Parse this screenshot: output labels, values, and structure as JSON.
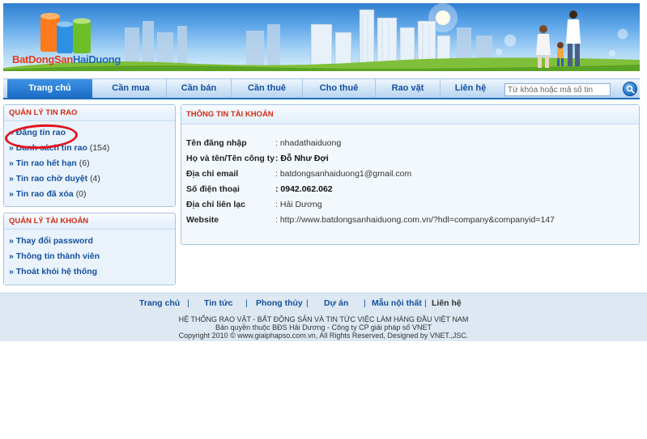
{
  "banner": {
    "logo_part1": "BatDongSan",
    "logo_part2": "HaiDuong"
  },
  "nav": {
    "items": [
      "Trang chủ",
      "Cần mua",
      "Cần bán",
      "Cần thuê",
      "Cho thuê",
      "Rao vặt",
      "Liên hệ"
    ],
    "active_index": 0,
    "search_placeholder": "Từ khóa hoặc mã số tin"
  },
  "sidebar": {
    "listings_title": "QUẢN LÝ TIN RAO",
    "listings": [
      {
        "label": "Đăng tin rao",
        "count": ""
      },
      {
        "label": "Danh sách tin rao",
        "count": "(154)"
      },
      {
        "label": "Tin rao hết hạn",
        "count": "(6)"
      },
      {
        "label": "Tin rao chờ duyệt",
        "count": "(4)"
      },
      {
        "label": "Tin rao đã xóa",
        "count": "(0)"
      }
    ],
    "account_title": "QUẢN LÝ TÀI KHOẢN",
    "account": [
      {
        "label": "Thay đổi password"
      },
      {
        "label": "Thông tin thành viên"
      },
      {
        "label": "Thoát khỏi hệ thống"
      }
    ]
  },
  "account_info": {
    "title": "THÔNG TIN TÀI KHOẢN",
    "rows": [
      {
        "label": "Tên đăng nhập",
        "value": ": nhadathaiduong",
        "bold": false
      },
      {
        "label": "Họ và tên/Tên công ty",
        "value": ": Đỗ Như Đợi",
        "bold": true
      },
      {
        "label": "Địa chỉ email",
        "value": ": batdongsanhaiduong1@gmail.com",
        "bold": false
      },
      {
        "label": "Số điện thoại",
        "value": ": 0942.062.062",
        "bold": true
      },
      {
        "label": "Địa chỉ liên lạc",
        "value": ": Hải Dương",
        "bold": false
      },
      {
        "label": "Website",
        "value": ": http://www.batdongsanhaiduong.com.vn/?hdl=company&companyid=147",
        "bold": false
      }
    ]
  },
  "footer": {
    "links": [
      "Trang chủ",
      "Tin tức",
      "Phong thủy",
      "Dự án",
      "Mẫu nội thất",
      "Liên hệ"
    ],
    "line1": "HỆ THỐNG RAO VẶT - BẤT ĐỘNG SẢN VÀ TIN TỨC VIỆC LÀM HÀNG ĐẦU VIỆT NAM",
    "line2": "Bản quyền thuộc BĐS Hải Dương - Công ty CP giải pháp số VNET",
    "line3": "Copyright 2010 © www.giaiphapso.com.vn, All Rights Reserved, Designed by VNET.,JSC."
  },
  "colors": {
    "accent_blue": "#1f6fc0",
    "heading_red": "#d42a12",
    "annotation_red": "#e3141b"
  }
}
